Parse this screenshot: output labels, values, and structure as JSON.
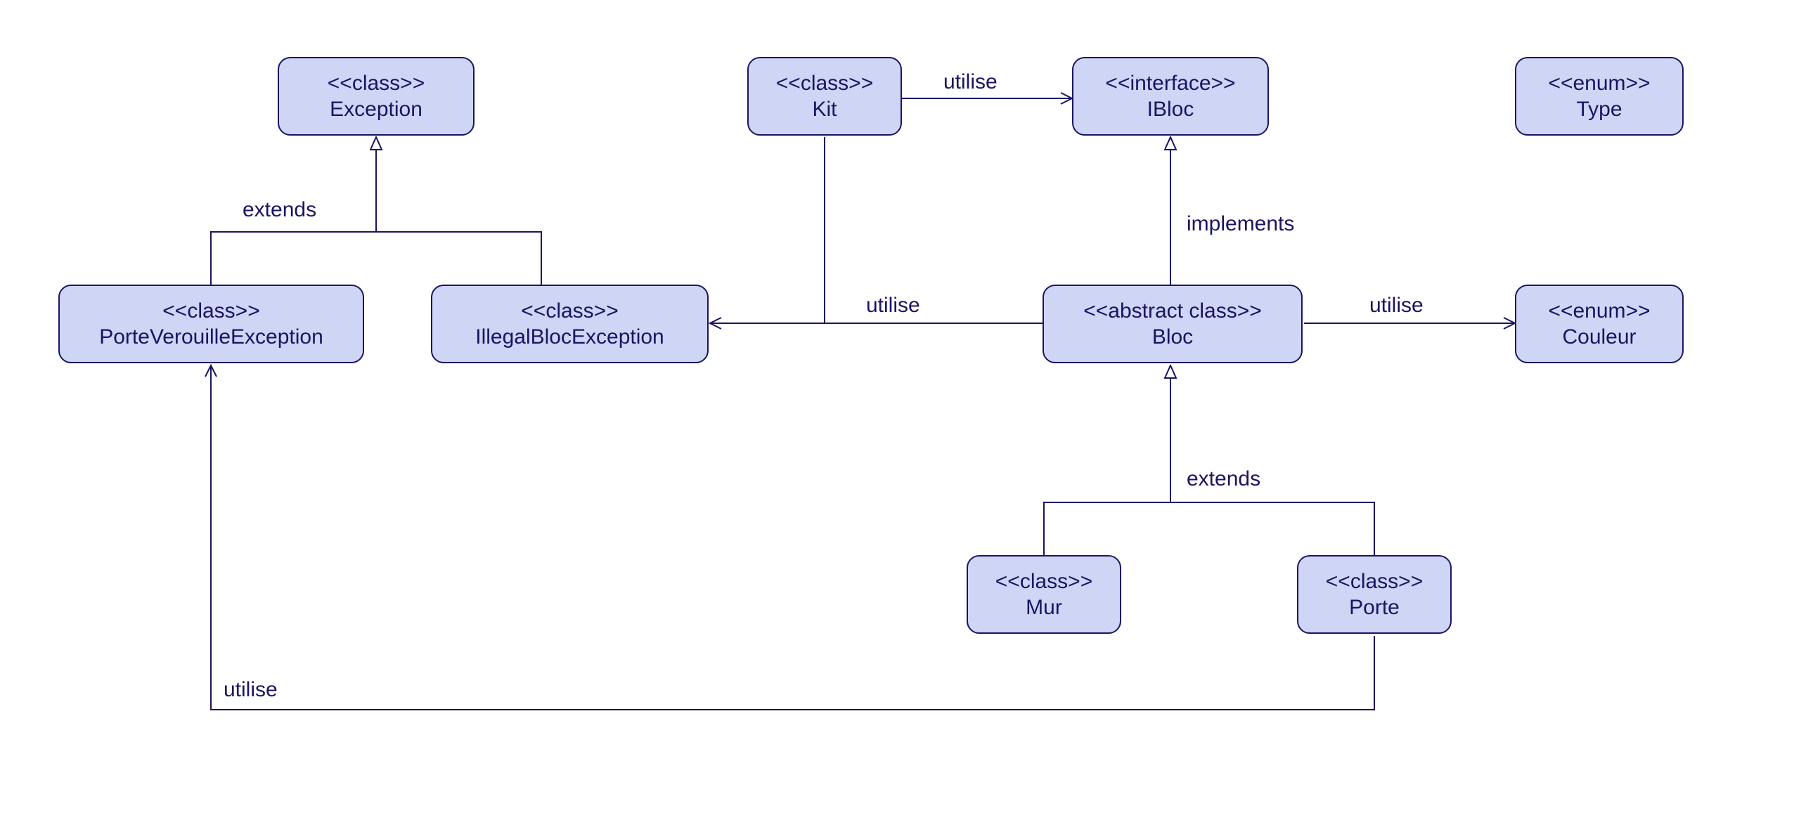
{
  "diagram": {
    "type": "uml-class-diagram",
    "nodes": {
      "exception": {
        "stereotype": "<<class>>",
        "name": "Exception"
      },
      "kit": {
        "stereotype": "<<class>>",
        "name": "Kit"
      },
      "ibloc": {
        "stereotype": "<<interface>>",
        "name": "IBloc"
      },
      "type": {
        "stereotype": "<<enum>>",
        "name": "Type"
      },
      "porteVerouilleExc": {
        "stereotype": "<<class>>",
        "name": "PorteVerouilleException"
      },
      "illegalBlocExc": {
        "stereotype": "<<class>>",
        "name": "IllegalBlocException"
      },
      "bloc": {
        "stereotype": "<<abstract class>>",
        "name": "Bloc"
      },
      "couleur": {
        "stereotype": "<<enum>>",
        "name": "Couleur"
      },
      "mur": {
        "stereotype": "<<class>>",
        "name": "Mur"
      },
      "porte": {
        "stereotype": "<<class>>",
        "name": "Porte"
      }
    },
    "edges": {
      "extends1": {
        "label": "extends",
        "from": "porteVerouilleExc,illegalBlocExc",
        "to": "exception",
        "kind": "generalization"
      },
      "kit_ibloc": {
        "label": "utilise",
        "from": "kit",
        "to": "ibloc",
        "kind": "dependency"
      },
      "bloc_ibloc": {
        "label": "implements",
        "from": "bloc",
        "to": "ibloc",
        "kind": "realization"
      },
      "bloc_ill": {
        "label": "utilise",
        "from": "bloc",
        "to": "illegalBlocExc",
        "kind": "dependency"
      },
      "bloc_coul": {
        "label": "utilise",
        "from": "bloc",
        "to": "couleur",
        "kind": "dependency"
      },
      "extends2": {
        "label": "extends",
        "from": "mur,porte",
        "to": "bloc",
        "kind": "generalization"
      },
      "porte_pve": {
        "label": "utilise",
        "from": "porte",
        "to": "porteVerouilleExc",
        "kind": "dependency"
      }
    }
  }
}
